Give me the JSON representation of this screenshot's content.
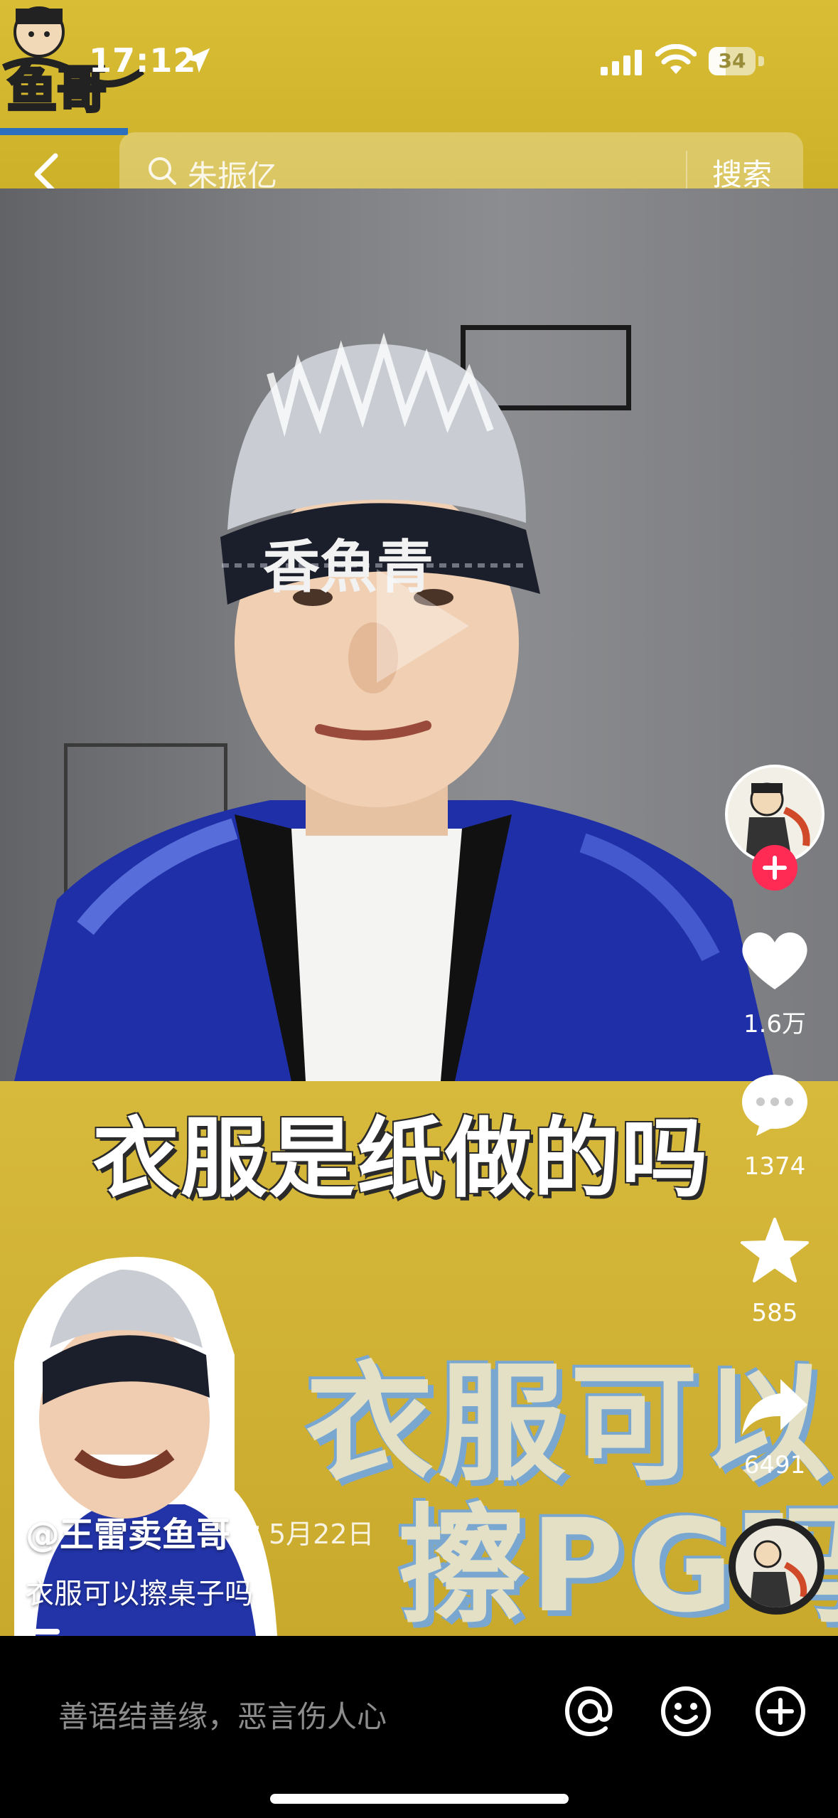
{
  "status_bar": {
    "time": "17:12",
    "battery": "34"
  },
  "search": {
    "query": "朱振亿",
    "button_label": "搜索"
  },
  "video": {
    "caption": "衣服是纸做的吗",
    "poster_line1": "衣服可以",
    "poster_line2": "擦PG吗",
    "headband_text": "香魚青"
  },
  "actions": {
    "likes": "1.6万",
    "comments": "1374",
    "favorites": "585",
    "shares": "6491"
  },
  "post": {
    "author": "@王雷卖鱼哥",
    "separator": "·",
    "date": "5月22日",
    "description": "衣服可以擦桌子吗"
  },
  "comment_bar": {
    "placeholder": "善语结善缘，恶言伤人心"
  },
  "colors": {
    "brand_yellow": "#d7b93b",
    "follow_red": "#ff2b55",
    "poster_outline": "#7aa7d0"
  },
  "icons": [
    "location-arrow-icon",
    "signal-icon",
    "wifi-icon",
    "back-icon",
    "search-icon",
    "play-icon",
    "plus-icon",
    "heart-icon",
    "comment-icon",
    "star-icon",
    "share-icon",
    "at-icon",
    "emoji-icon",
    "add-icon"
  ]
}
